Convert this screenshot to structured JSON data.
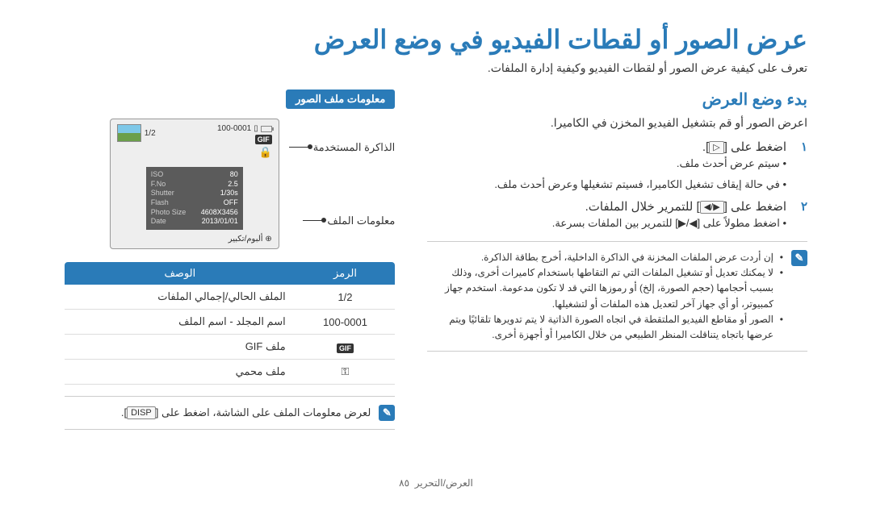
{
  "title": "عرض الصور أو لقطات الفيديو في وضع العرض",
  "subtitle": "تعرف على كيفية عرض الصور أو لقطات الفيديو وكيفية إدارة الملفات.",
  "section_title": "بدء وضع العرض",
  "intro": "اعرض الصور أو قم بتشغيل الفيديو المخزن في الكاميرا.",
  "step1": {
    "num": "١",
    "text_before": "اضغط على ",
    "button": "▷",
    "text_after": "."
  },
  "sub1a": "سيتم عرض أحدث ملف.",
  "sub1b": "في حالة إيقاف تشغيل الكاميرا، فسيتم تشغيلها وعرض أحدث ملف.",
  "step2": {
    "num": "٢",
    "text_before": "اضغط على ",
    "button": "◀/▶",
    "text_after": " للتمرير خلال الملفات."
  },
  "sub2": "اضغط مطولاً على [◀/▶] للتمرير بين الملفات بسرعة.",
  "notes": [
    "إن أردت عرض الملفات المخزنة في الذاكرة الداخلية، أخرج بطاقة الذاكرة.",
    "لا يمكنك تعديل أو تشغيل الملفات التي تم التقاطها باستخدام كاميرات أخرى، وذلك بسبب أحجامها (حجم الصورة، إلخ) أو رموزها التي قد لا تكون مدعومة. استخدم جهاز كمبيوتر، أو أي جهاز آخر لتعديل هذه الملفات أو لتشغيلها.",
    "الصور أو مقاطع الفيديو الملتقطة في اتجاه الصورة الذاتية لا يتم تدويرها تلقائيًا ويتم عرضها باتجاه يتناقلت المنظر الطبيعي من خلال الكاميرا أو أجهزة أخرى."
  ],
  "info_header": "معلومات ملف الصور",
  "labels": {
    "memory": "الذاكرة المستخدمة",
    "fileinfo": "معلومات الملف"
  },
  "lcd": {
    "counter": "1/2",
    "folder": "100-0001",
    "iso_k": "ISO",
    "iso_v": "80",
    "fno_k": "F.No",
    "fno_v": "2.5",
    "shutter_k": "Shutter",
    "shutter_v": "1/30s",
    "flash_k": "Flash",
    "flash_v": "OFF",
    "size_k": "Photo Size",
    "size_v": "4608X3456",
    "date_k": "Date",
    "date_v": "2013/01/01",
    "bottom": "ألبوم/تكبير"
  },
  "table": {
    "h1": "الرمز",
    "h2": "الوصف",
    "r1_sym": "1/2",
    "r1_desc": "الملف الحالي/إجمالي الملفات",
    "r2_sym": "100-0001",
    "r2_desc": "اسم المجلد - اسم الملف",
    "r3_sym": "GIF",
    "r3_desc": "ملف GIF",
    "r4_desc": "ملف محمي"
  },
  "disp_note": {
    "text_before": "لعرض معلومات الملف على الشاشة، اضغط على ",
    "button": "DISP",
    "text_after": "."
  },
  "footer": {
    "section": "العرض/التحرير",
    "page": "٨٥"
  }
}
